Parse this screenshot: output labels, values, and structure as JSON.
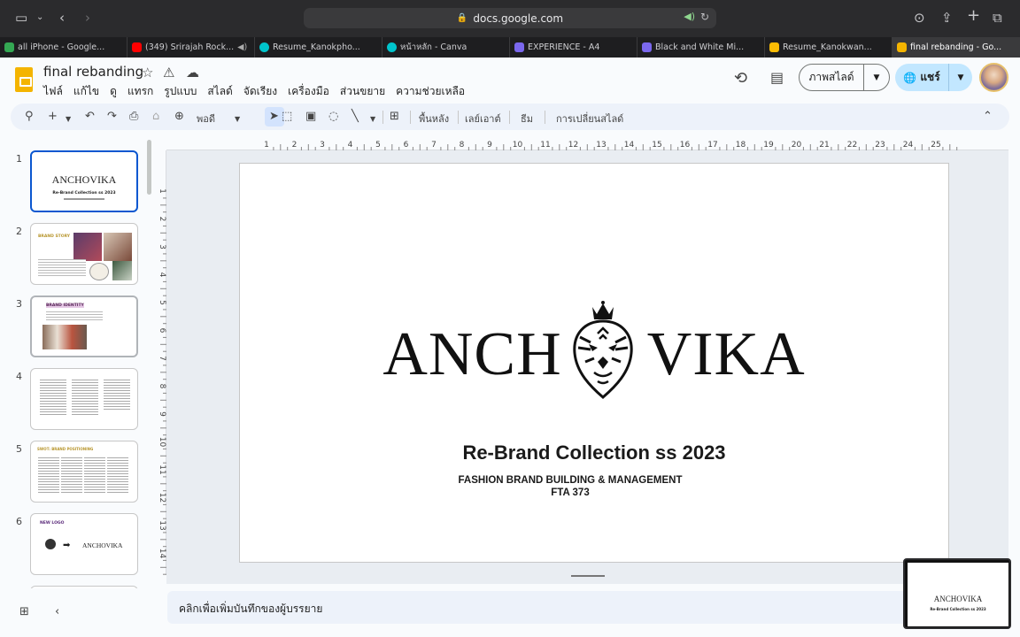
{
  "browser": {
    "url": "docs.google.com",
    "tabs": [
      {
        "label": "all iPhone - Google...",
        "color": "#34a853"
      },
      {
        "label": "(349) Srirajah Rock...",
        "color": "#ff0000"
      },
      {
        "label": "Resume_Kanokpho...",
        "color": "#00c4cc"
      },
      {
        "label": "หน้าหลัก - Canva",
        "color": "#00c4cc"
      },
      {
        "label": "EXPERIENCE - A4",
        "color": "#7b68ee"
      },
      {
        "label": "Black and White Mi...",
        "color": "#7b68ee"
      },
      {
        "label": "Resume_Kanokwan...",
        "color": "#fbbc04"
      },
      {
        "label": "final rebanding - Go...",
        "color": "#f4b400"
      }
    ]
  },
  "doc": {
    "title": "final rebanding",
    "menu": [
      "ไฟล์",
      "แก้ไข",
      "ดู",
      "แทรก",
      "รูปแบบ",
      "สไลด์",
      "จัดเรียง",
      "เครื่องมือ",
      "ส่วนขยาย",
      "ความช่วยเหลือ"
    ],
    "slideshow_label": "ภาพสไลด์",
    "share_label": "แชร์"
  },
  "toolbar": {
    "zoom": "พอดี",
    "background": "พื้นหลัง",
    "layout": "เลย์เอาต์",
    "theme": "ธีม",
    "transition": "การเปลี่ยนสไลด์"
  },
  "ruler": {
    "h": [
      "1",
      "2",
      "3",
      "4",
      "5",
      "6",
      "7",
      "8",
      "9",
      "10",
      "11",
      "12",
      "13",
      "14",
      "15",
      "16",
      "17",
      "18",
      "19",
      "20",
      "21",
      "22",
      "23",
      "24",
      "25"
    ],
    "v": [
      "1",
      "2",
      "3",
      "4",
      "5",
      "6",
      "7",
      "8",
      "9",
      "10",
      "11",
      "12",
      "13",
      "14"
    ]
  },
  "slides": [
    "1",
    "2",
    "3",
    "4",
    "5",
    "6"
  ],
  "thumbs": {
    "t1_title": "ANCHOVIKA",
    "t1_sub": "Re-Brand Collection ss 2023",
    "t2_title": "BRAND STORY",
    "t3_title": "BRAND IDENTITY",
    "t5_title": "SWOT: BRAND POSITIONING",
    "t6_title": "NEW LOGO",
    "t6_logo": "ANCHOVIKA"
  },
  "slide": {
    "brand_left": "ANCH",
    "brand_right": "VIKA",
    "subtitle": "Re-Brand Collection ss 2023",
    "line1": "FASHION BRAND BUILDING & MANAGEMENT",
    "line2": "FTA 373"
  },
  "notes_placeholder": "คลิกเพื่อเพิ่มบันทึกของผู้บรรยาย",
  "colors": {
    "accent": "#0b57d0",
    "share_bg": "#c2e7ff",
    "slides_logo": "#f4b400"
  }
}
